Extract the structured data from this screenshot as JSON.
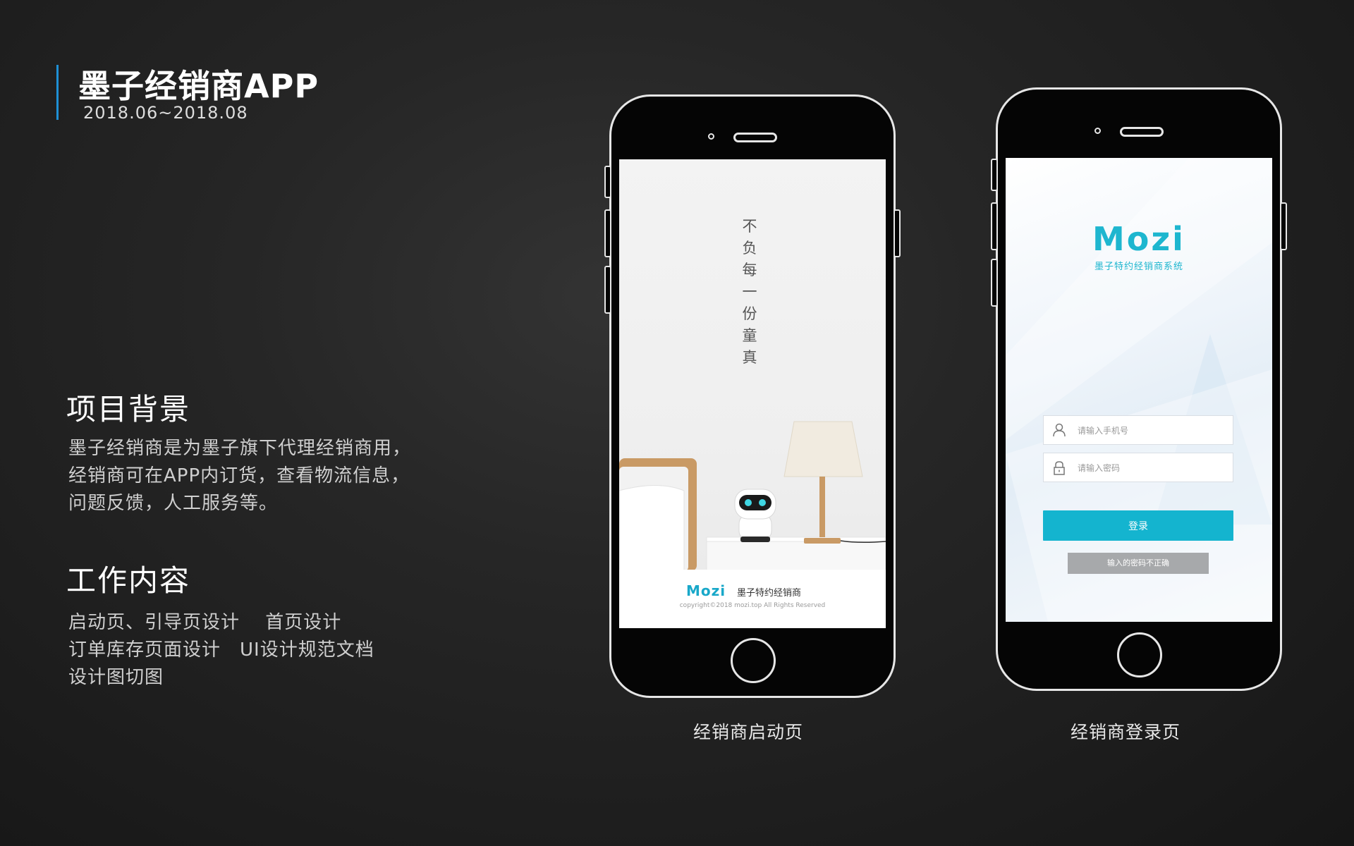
{
  "header": {
    "title": "墨子经销商APP",
    "date_range": "2018.06~2018.08"
  },
  "background_section": {
    "heading": "项目背景",
    "lines": [
      "墨子经销商是为墨子旗下代理经销商用，",
      "经销商可在APP内订货，查看物流信息，",
      "问题反馈，人工服务等。"
    ]
  },
  "work_section": {
    "heading": "工作内容",
    "lines": [
      "启动页、引导页设计　 首页设计",
      "订单库存页面设计　UI设计规范文档",
      "设计图切图"
    ]
  },
  "splash_phone": {
    "caption": "经销商启动页",
    "vertical_slogan": [
      "不",
      "负",
      "每",
      "一",
      "份",
      "童",
      "真"
    ],
    "brand": "Mozi",
    "brand_sub": "墨子特约经销商",
    "copyright": "copyright©2018 mozi.top All Rights Reserved"
  },
  "login_phone": {
    "caption": "经销商登录页",
    "logo": "Mozi",
    "logo_sub": "墨子特约经销商系统",
    "phone_placeholder": "请输入手机号",
    "password_placeholder": "请输入密码",
    "login_label": "登录",
    "error_text": "输入的密码不正确"
  },
  "colors": {
    "accent": "#1e90d6",
    "brand": "#14b4cf",
    "toast": "#a7a9ab"
  }
}
